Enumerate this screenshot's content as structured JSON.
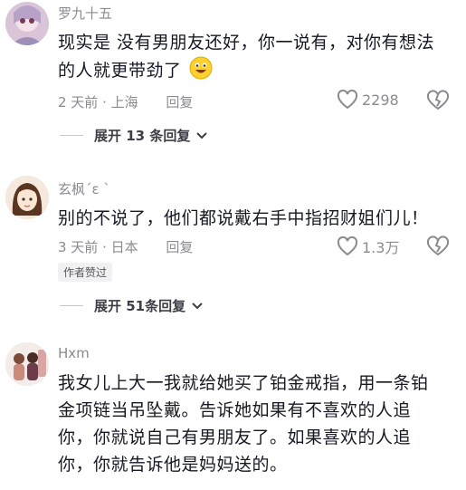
{
  "comments": [
    {
      "username": "罗九十五",
      "text_line1": "现实是 没有男朋友还好，你一说有，对你有想法",
      "text_line2": "的人就更带劲了",
      "time_location": "2 天前 · 上海",
      "reply_label": "回复",
      "likes": "2298",
      "replies_label": "展开 13 条回复"
    },
    {
      "username": "玄枫ˊε ˋ",
      "text_line1": "别的不说了，他们都说戴右手中指招财姐们儿！",
      "time_location": "3 天前 · 日本",
      "reply_label": "回复",
      "likes": "1.3万",
      "badge": "作者赞过",
      "replies_label": "展开 51条回复"
    },
    {
      "username": "Hxm",
      "text_line1": "我女儿上大一我就给她买了铂金戒指，用一条铂",
      "text_line2": "金项链当吊坠戴。告诉她如果有不喜欢的人追",
      "text_line3": "你，你就说自己有男朋友了。如果喜欢的人追",
      "text_line4": "你，你就告诉他是妈妈送的。"
    }
  ],
  "icons": {
    "like": "heart-outline-icon",
    "dislike": "broken-heart-icon",
    "expand": "chevron-down-icon",
    "emoji": "grinning-face-icon"
  }
}
